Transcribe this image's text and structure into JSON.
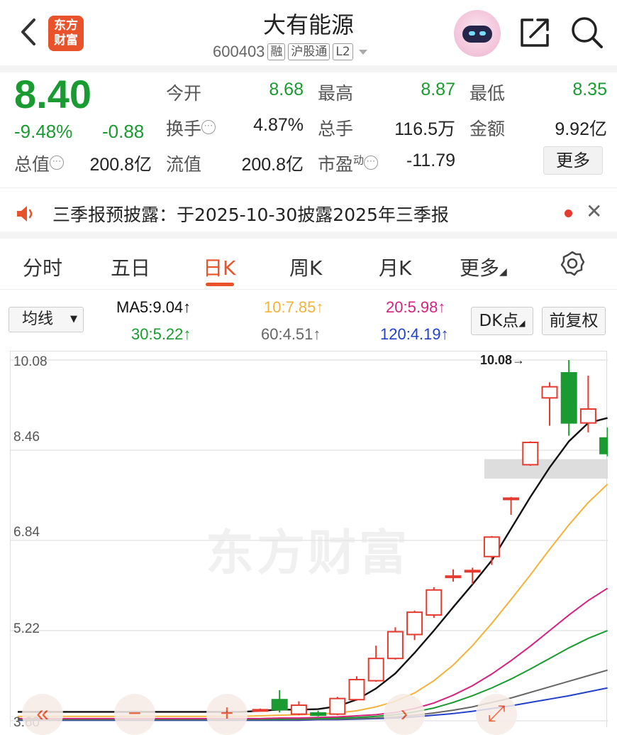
{
  "header": {
    "logo_line1": "东方",
    "logo_line2": "财富",
    "title": "大有能源",
    "code": "600403",
    "tag_rong": "融",
    "tag_hgt": "沪股通",
    "tag_l2": "L2"
  },
  "quote": {
    "price": "8.40",
    "change_pct": "-9.48%",
    "change_amt": "-0.88",
    "fields": [
      {
        "label": "今开",
        "value": "8.68"
      },
      {
        "label": "最高",
        "value": "8.87"
      },
      {
        "label": "最低",
        "value": "8.35"
      },
      {
        "label": "换手",
        "value": "4.87%"
      },
      {
        "label": "总手",
        "value": "116.5万"
      },
      {
        "label": "金额",
        "value": "9.92亿"
      },
      {
        "label": "总值",
        "value": "200.8亿"
      },
      {
        "label": "流值",
        "value": "200.8亿"
      },
      {
        "label": "市盈",
        "value": "-11.79",
        "sup": "动"
      }
    ],
    "more_label": "更多"
  },
  "notice": {
    "text": "三季报预披露：于2025-10-30披露2025年三季报"
  },
  "tabs": [
    {
      "label": "分时"
    },
    {
      "label": "五日"
    },
    {
      "label": "日K"
    },
    {
      "label": "周K"
    },
    {
      "label": "月K"
    },
    {
      "label": "更多"
    }
  ],
  "active_tab": "日K",
  "indicator": {
    "select_label": "均线",
    "ma5": "MA5:9.04↑",
    "ma10": "10:7.85↑",
    "ma20": "20:5.98↑",
    "ma30": "30:5.22↑",
    "ma60": "60:4.51↑",
    "ma120": "120:4.19↑",
    "dk_label": "DK点",
    "fq_label": "前复权"
  },
  "colors": {
    "up": "#e53a2f",
    "down": "#1a9b32",
    "ma5": "#111111",
    "ma10": "#f3b23a",
    "ma20": "#d6227f",
    "ma30": "#1a9b32",
    "ma60": "#666666",
    "ma120": "#2340c8",
    "accent": "#e8532b"
  },
  "chart_data": {
    "type": "candlestick",
    "y_ticks": [
      "10.08",
      "8.46",
      "6.84",
      "5.22",
      "3.60"
    ],
    "ylim": [
      3.6,
      10.08
    ],
    "high_marker": "10.08",
    "watermark": "东方财富",
    "candles": [
      {
        "o": 3.8,
        "c": 3.8,
        "h": 3.82,
        "l": 3.78
      },
      {
        "o": 3.98,
        "c": 3.8,
        "h": 4.15,
        "l": 3.75
      },
      {
        "o": 3.72,
        "c": 3.88,
        "h": 3.95,
        "l": 3.7
      },
      {
        "o": 3.74,
        "c": 3.7,
        "h": 3.78,
        "l": 3.68
      },
      {
        "o": 3.72,
        "c": 4.0,
        "h": 4.03,
        "l": 3.7
      },
      {
        "o": 3.98,
        "c": 4.34,
        "h": 4.4,
        "l": 3.96
      },
      {
        "o": 4.32,
        "c": 4.72,
        "h": 4.95,
        "l": 4.3
      },
      {
        "o": 4.72,
        "c": 5.2,
        "h": 5.28,
        "l": 4.7
      },
      {
        "o": 5.15,
        "c": 5.55,
        "h": 5.58,
        "l": 5.05
      },
      {
        "o": 5.5,
        "c": 5.95,
        "h": 6.0,
        "l": 5.45
      },
      {
        "o": 6.2,
        "c": 6.2,
        "h": 6.32,
        "l": 6.1
      },
      {
        "o": 6.3,
        "c": 6.3,
        "h": 6.35,
        "l": 6.05
      },
      {
        "o": 6.55,
        "c": 6.9,
        "h": 6.92,
        "l": 6.4
      },
      {
        "o": 7.6,
        "c": 7.6,
        "h": 7.62,
        "l": 7.3
      },
      {
        "o": 8.2,
        "c": 8.6,
        "h": 8.62,
        "l": 8.18
      },
      {
        "o": 9.4,
        "c": 9.6,
        "h": 9.68,
        "l": 8.9
      },
      {
        "o": 9.85,
        "c": 8.95,
        "h": 10.08,
        "l": 8.72
      },
      {
        "o": 8.95,
        "c": 9.2,
        "h": 9.8,
        "l": 8.78
      },
      {
        "o": 8.68,
        "c": 8.4,
        "h": 8.87,
        "l": 8.35
      }
    ],
    "ma_series": [
      {
        "name": "MA5",
        "values": [
          3.76,
          3.78,
          3.8,
          3.8,
          3.81,
          3.86,
          3.98,
          4.18,
          4.45,
          4.82,
          5.22,
          5.64,
          6.05,
          6.48,
          7.05,
          7.62,
          8.15,
          8.62,
          8.95,
          9.04
        ]
      },
      {
        "name": "MA10",
        "values": [
          3.68,
          3.69,
          3.7,
          3.71,
          3.72,
          3.74,
          3.78,
          3.85,
          3.95,
          4.1,
          4.32,
          4.6,
          4.95,
          5.35,
          5.78,
          6.22,
          6.68,
          7.12,
          7.52,
          7.85
        ]
      },
      {
        "name": "MA20",
        "values": [
          3.64,
          3.64,
          3.65,
          3.65,
          3.66,
          3.67,
          3.69,
          3.71,
          3.75,
          3.82,
          3.92,
          4.06,
          4.23,
          4.44,
          4.68,
          4.94,
          5.22,
          5.5,
          5.76,
          5.98
        ]
      },
      {
        "name": "MA30",
        "values": [
          3.63,
          3.63,
          3.63,
          3.64,
          3.64,
          3.65,
          3.66,
          3.68,
          3.71,
          3.76,
          3.83,
          3.93,
          4.05,
          4.19,
          4.35,
          4.53,
          4.72,
          4.91,
          5.08,
          5.22
        ]
      },
      {
        "name": "MA60",
        "values": [
          3.62,
          3.62,
          3.62,
          3.62,
          3.63,
          3.63,
          3.64,
          3.65,
          3.67,
          3.7,
          3.74,
          3.79,
          3.85,
          3.93,
          4.01,
          4.11,
          4.21,
          4.31,
          4.41,
          4.51
        ]
      },
      {
        "name": "MA120",
        "values": [
          3.61,
          3.61,
          3.61,
          3.61,
          3.62,
          3.62,
          3.63,
          3.64,
          3.65,
          3.67,
          3.7,
          3.73,
          3.77,
          3.82,
          3.87,
          3.93,
          3.99,
          4.05,
          4.12,
          4.19
        ]
      }
    ],
    "support_band": [
      7.95,
      8.3
    ]
  }
}
